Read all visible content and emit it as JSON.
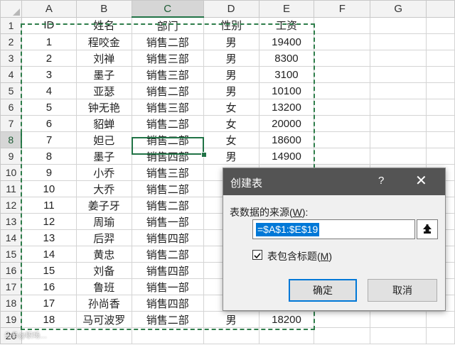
{
  "columns": [
    "A",
    "B",
    "C",
    "D",
    "E",
    "F",
    "G"
  ],
  "row_numbers": [
    "1",
    "2",
    "3",
    "4",
    "5",
    "6",
    "7",
    "8",
    "9",
    "10",
    "11",
    "12",
    "13",
    "14",
    "15",
    "16",
    "17",
    "18",
    "19",
    "20"
  ],
  "rows": [
    [
      "ID",
      "姓名",
      "部门",
      "性别",
      "工资"
    ],
    [
      "1",
      "程咬金",
      "销售二部",
      "男",
      "19400"
    ],
    [
      "2",
      "刘禅",
      "销售三部",
      "男",
      "8300"
    ],
    [
      "3",
      "墨子",
      "销售三部",
      "男",
      "3100"
    ],
    [
      "4",
      "亚瑟",
      "销售二部",
      "男",
      "10100"
    ],
    [
      "5",
      "钟无艳",
      "销售三部",
      "女",
      "13200"
    ],
    [
      "6",
      "貂蝉",
      "销售二部",
      "女",
      "20000"
    ],
    [
      "7",
      "妲己",
      "销售二部",
      "女",
      "18600"
    ],
    [
      "8",
      "墨子",
      "销售四部",
      "男",
      "14900"
    ],
    [
      "9",
      "小乔",
      "销售三部",
      "",
      ""
    ],
    [
      "10",
      "大乔",
      "销售二部",
      "",
      ""
    ],
    [
      "11",
      "姜子牙",
      "销售二部",
      "",
      ""
    ],
    [
      "12",
      "周瑜",
      "销售一部",
      "",
      ""
    ],
    [
      "13",
      "后羿",
      "销售四部",
      "",
      ""
    ],
    [
      "14",
      "黄忠",
      "销售二部",
      "",
      ""
    ],
    [
      "15",
      "刘备",
      "销售四部",
      "",
      ""
    ],
    [
      "16",
      "鲁班",
      "销售一部",
      "",
      ""
    ],
    [
      "17",
      "孙尚香",
      "销售四部",
      "",
      ""
    ],
    [
      "18",
      "马可波罗",
      "销售二部",
      "男",
      "18200"
    ]
  ],
  "dialog": {
    "title": "创建表",
    "help": "?",
    "close": "✕",
    "source_label": "表数据的来源(",
    "source_key": "W",
    "source_label_end": "):",
    "range_value": "=$A$1:$E$19",
    "checkbox_checked": true,
    "checkbox_label": "表包含标题(",
    "checkbox_key": "M",
    "checkbox_label_end": ")",
    "ok_label": "确定",
    "cancel_label": "取消"
  },
  "watermark": "头条@职场…"
}
